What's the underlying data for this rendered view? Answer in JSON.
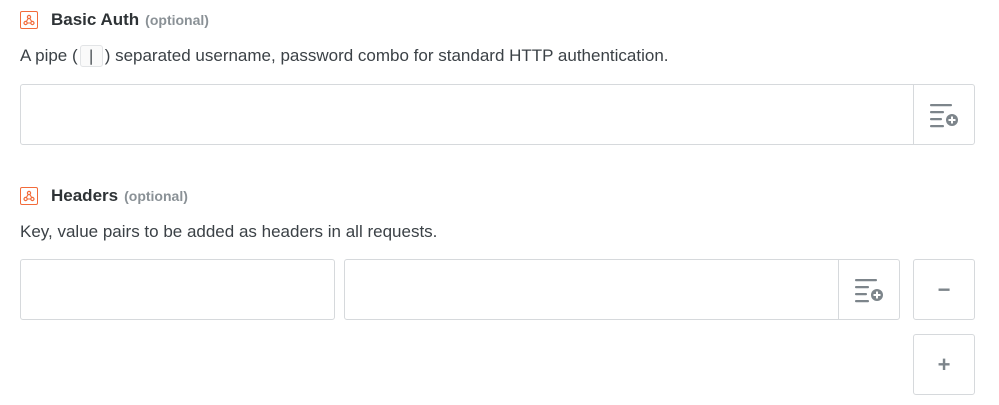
{
  "basic_auth": {
    "title": "Basic Auth",
    "optional_label": "(optional)",
    "description_before": "A pipe (",
    "pipe_symbol": "|",
    "description_after": ") separated username, password combo for standard HTTP authentication.",
    "value": "",
    "icon": "webhook-icon",
    "insert_icon": "insert-field-icon"
  },
  "headers": {
    "title": "Headers",
    "optional_label": "(optional)",
    "description": "Key, value pairs to be added as headers in all requests.",
    "key_value": "",
    "value_value": "",
    "remove_label": "−",
    "add_label": "+",
    "icon": "webhook-icon",
    "insert_icon": "insert-field-icon"
  },
  "colors": {
    "accent": "#f26b3a",
    "border": "#d6d9dc",
    "icon_gray": "#7d858b"
  }
}
